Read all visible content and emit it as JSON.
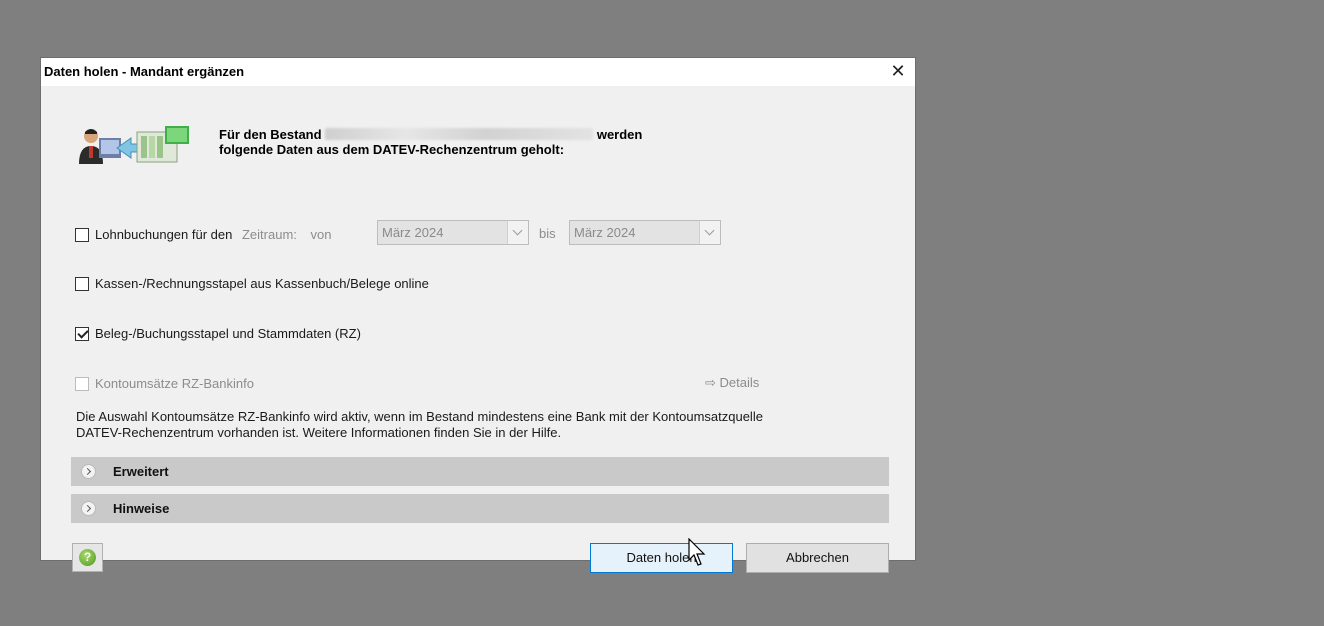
{
  "window": {
    "title": "Daten holen - Mandant ergänzen",
    "close_glyph": "✕"
  },
  "intro": {
    "line1_prefix": "Für den Bestand",
    "line1_suffix": "werden",
    "line2": "folgende Daten aus dem DATEV-Rechenzentrum geholt:"
  },
  "options": {
    "lohn": {
      "label": "Lohnbuchungen für den",
      "checked": false,
      "zeitraum_label": "Zeitraum:",
      "von_label": "von",
      "von_value": "März 2024",
      "bis_label": "bis",
      "bis_value": "März 2024"
    },
    "kassen": {
      "label": "Kassen-/Rechnungsstapel aus Kassenbuch/Belege online",
      "checked": false
    },
    "beleg": {
      "label": "Beleg-/Buchungsstapel und Stammdaten (RZ)",
      "checked": true
    },
    "konto": {
      "label": "Kontoumsätze RZ-Bankinfo",
      "checked": false,
      "disabled": true,
      "details_label": "⇨ Details"
    }
  },
  "info_text": {
    "line1": "Die Auswahl Kontoumsätze RZ-Bankinfo wird aktiv, wenn im Bestand mindestens eine Bank mit der Kontoumsatzquelle",
    "line2": "DATEV-Rechenzentrum vorhanden ist. Weitere Informationen finden Sie in der Hilfe."
  },
  "sections": [
    {
      "title": "Erweitert"
    },
    {
      "title": "Hinweise"
    }
  ],
  "buttons": {
    "help_glyph": "?",
    "ok_label": "Daten holen",
    "cancel_label": "Abbrechen"
  },
  "colors": {
    "accent": "#0078d7",
    "section_bg": "#c9c9c9",
    "dialog_bg": "#f0f0f0"
  }
}
